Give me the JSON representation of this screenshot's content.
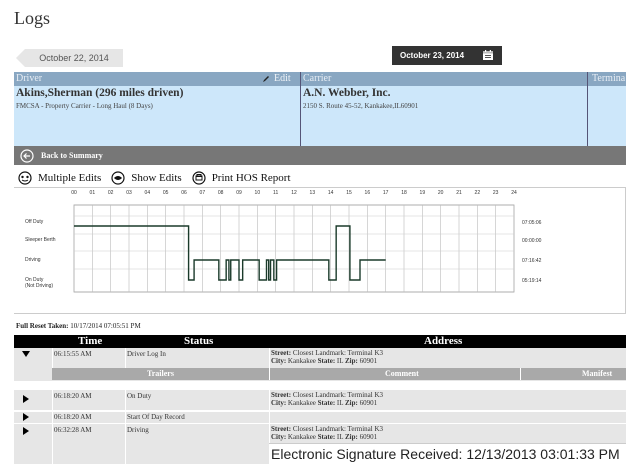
{
  "page": {
    "title": "Logs"
  },
  "date_nav": {
    "previous": "October 22, 2014",
    "current": "October 23, 2014"
  },
  "info": {
    "driver_header": "Driver",
    "edit_label": "Edit",
    "carrier_header": "Carrier",
    "terminal_header": "Termina",
    "driver_name": "Akins,Sherman (296 miles driven)",
    "driver_detail": "FMCSA - Property Carrier - Long Haul (8 Days)",
    "carrier_name": "A.N. Webber, Inc.",
    "carrier_address": "2150 S. Route 45-52, Kankakee,IL60901"
  },
  "back_label": "Back to Summary",
  "toolbar": {
    "multiple_edits": "Multiple Edits",
    "show_edits": "Show Edits",
    "print_hos": "Print HOS Report"
  },
  "graph": {
    "hours": [
      "00",
      "01",
      "02",
      "03",
      "04",
      "05",
      "06",
      "07",
      "08",
      "09",
      "10",
      "11",
      "12",
      "13",
      "14",
      "15",
      "16",
      "17",
      "18",
      "19",
      "20",
      "21",
      "22",
      "23",
      "24"
    ],
    "statuses": [
      {
        "label": "Off Duty",
        "total": "07:05:06"
      },
      {
        "label": "Sleeper Berth",
        "total": "00:00:00"
      },
      {
        "label": "Driving",
        "total": "07:16:42"
      },
      {
        "label": "On Duty\n(Not Driving)",
        "total": "05:19:14"
      }
    ],
    "segments": [
      {
        "status": 0,
        "start": 0,
        "end": 6.25
      },
      {
        "status": 3,
        "start": 6.25,
        "end": 6.55
      },
      {
        "status": 2,
        "start": 6.55,
        "end": 7.9
      },
      {
        "status": 3,
        "start": 7.9,
        "end": 8.3
      },
      {
        "status": 2,
        "start": 8.3,
        "end": 8.45
      },
      {
        "status": 3,
        "start": 8.45,
        "end": 8.55
      },
      {
        "status": 2,
        "start": 8.55,
        "end": 9.0
      },
      {
        "status": 3,
        "start": 9.0,
        "end": 9.2
      },
      {
        "status": 2,
        "start": 9.2,
        "end": 10.1
      },
      {
        "status": 3,
        "start": 10.1,
        "end": 10.5
      },
      {
        "status": 2,
        "start": 10.5,
        "end": 10.62
      },
      {
        "status": 3,
        "start": 10.62,
        "end": 10.72
      },
      {
        "status": 2,
        "start": 10.72,
        "end": 10.9
      },
      {
        "status": 3,
        "start": 10.9,
        "end": 11.05
      },
      {
        "status": 2,
        "start": 11.05,
        "end": 13.9
      },
      {
        "status": 3,
        "start": 13.9,
        "end": 14.3
      },
      {
        "status": 0,
        "start": 14.3,
        "end": 15.05
      },
      {
        "status": 3,
        "start": 15.05,
        "end": 15.6
      },
      {
        "status": 2,
        "start": 15.6,
        "end": 17.0
      }
    ]
  },
  "reset": {
    "label": "Full Reset Taken:",
    "value": "10/17/2014 07:05:51 PM"
  },
  "log_table": {
    "headers": {
      "time": "Time",
      "status": "Status",
      "address": "Address"
    },
    "sub_headers": {
      "trailers": "Trailers",
      "comment": "Comment",
      "manifest": "Manifest"
    },
    "street_label": "Street:",
    "city_label": "City:",
    "state_label": "State:",
    "zip_label": "Zip:",
    "rows": [
      {
        "time": "06:15:55 AM",
        "status": "Driver Log In",
        "street": "Closest Landmark: Terminal K3",
        "city": "Kankakee",
        "state": "IL",
        "zip": "60901"
      },
      {
        "time": "06:18:20 AM",
        "status": "On Duty",
        "street": "Closest Landmark: Terminal K3",
        "city": "Kankakee",
        "state": "IL",
        "zip": "60901"
      },
      {
        "time": "06:18:20 AM",
        "status": "Start Of Day Record"
      },
      {
        "time": "06:32:28 AM",
        "status": "Driving",
        "street": "Closest Landmark: Terminal K3",
        "city": "Kankakee",
        "state": "IL",
        "zip": "60901"
      }
    ]
  },
  "esignature": "Electronic Signature Received: 12/13/2013 03:01:33 PM"
}
